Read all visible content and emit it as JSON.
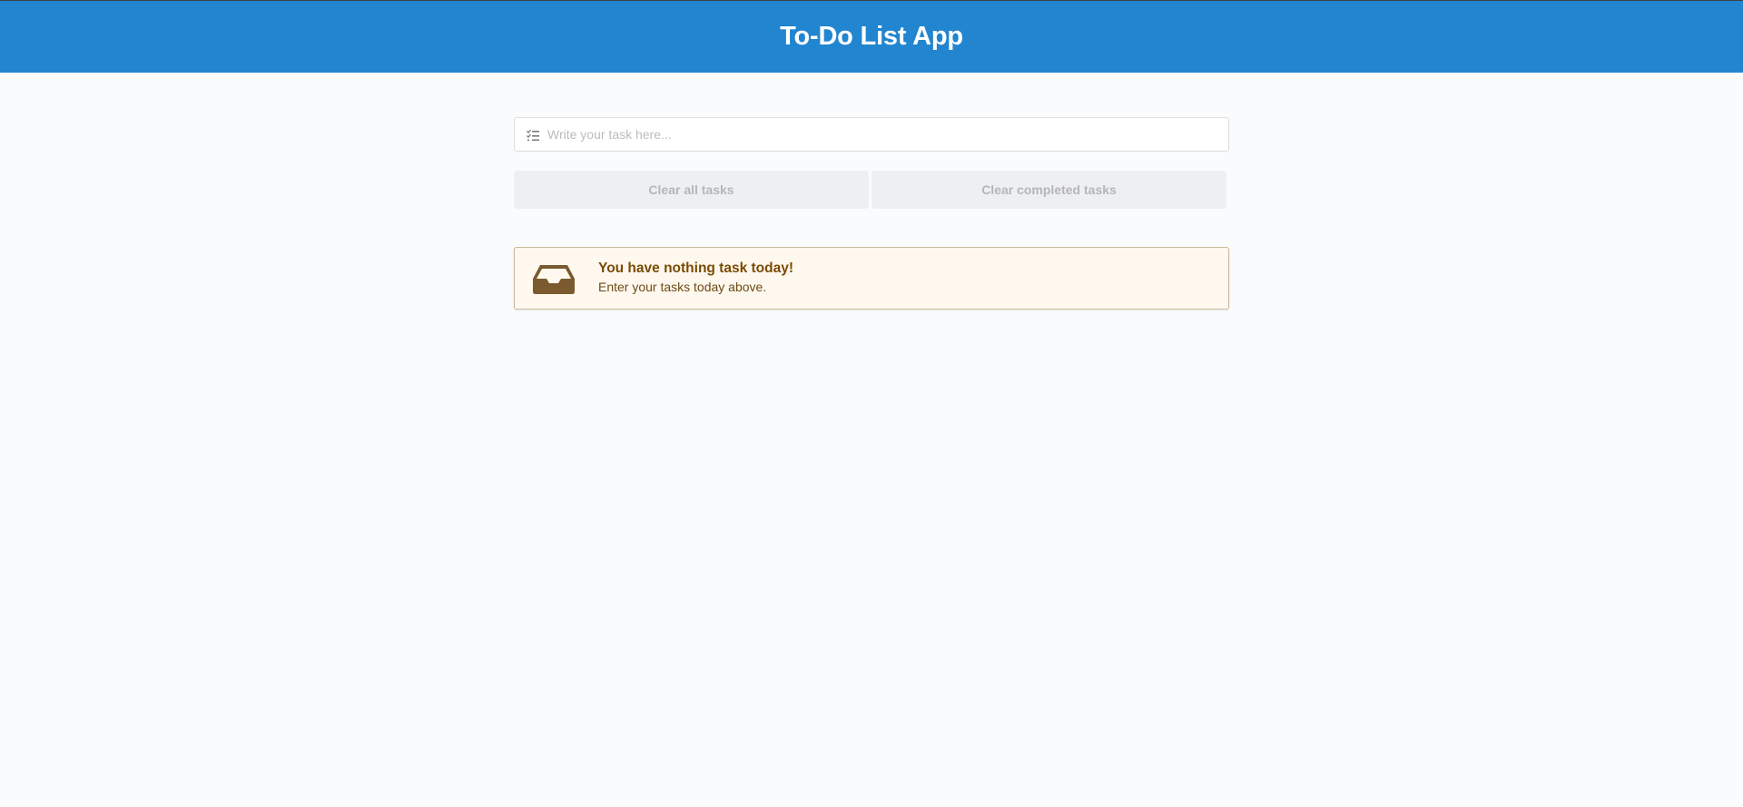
{
  "header": {
    "title": "To-Do List App",
    "background_color": "#2185d0"
  },
  "task_input": {
    "placeholder": "Write your task here...",
    "value": "",
    "icon": "tasks-list-icon"
  },
  "actions": {
    "clear_all_label": "Clear all tasks",
    "clear_completed_label": "Clear completed tasks"
  },
  "empty_message": {
    "icon": "inbox-icon",
    "title": "You have nothing task today!",
    "subtitle": "Enter your tasks today above.",
    "background_color": "#fff8ef",
    "text_color": "#794b02"
  }
}
